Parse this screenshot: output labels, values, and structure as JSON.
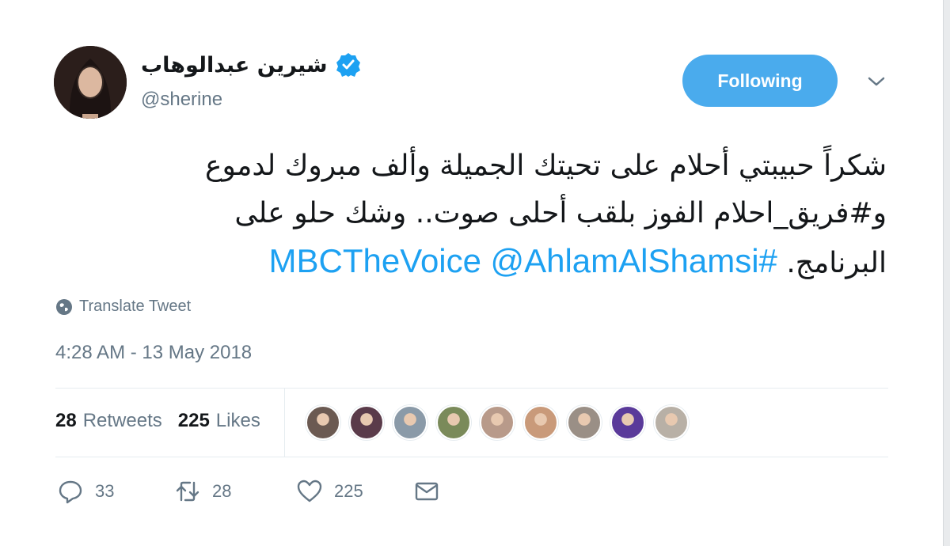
{
  "author": {
    "display_name": "شيرين عبدالوهاب",
    "handle": "@sherine",
    "verified_icon": "verified-badge-icon"
  },
  "follow_button": {
    "label": "Following"
  },
  "menu": {
    "icon": "chevron-down-icon"
  },
  "tweet": {
    "text_line1": "شكراً حبيبتي أحلام على تحيتك الجميلة وألف مبروك لدموع",
    "text_line2": "و#فريق_احلام الفوز بلقب أحلى صوت.. وشك حلو على",
    "text_line3": "البرنامج.",
    "mention": "@AhlamAlShamsi",
    "hashtag": "#MBCTheVoice",
    "translate_label": "Translate Tweet",
    "timestamp": "4:28 AM - 13 May 2018"
  },
  "stats": {
    "retweets_count": "28",
    "retweets_label": "Retweets",
    "likes_count": "225",
    "likes_label": "Likes"
  },
  "liker_avatar_colors": [
    "#6b5a52",
    "#5a3b4a",
    "#8a9aa8",
    "#7a8a5a",
    "#b89a8a",
    "#c99a7a",
    "#9a8f86",
    "#5a3a9a",
    "#b8b0a6"
  ],
  "actions": {
    "reply_count": "33",
    "retweet_count": "28",
    "like_count": "225"
  },
  "colors": {
    "accent": "#1da1f2",
    "follow_button_bg": "#4aabed",
    "secondary_text": "#657786"
  }
}
